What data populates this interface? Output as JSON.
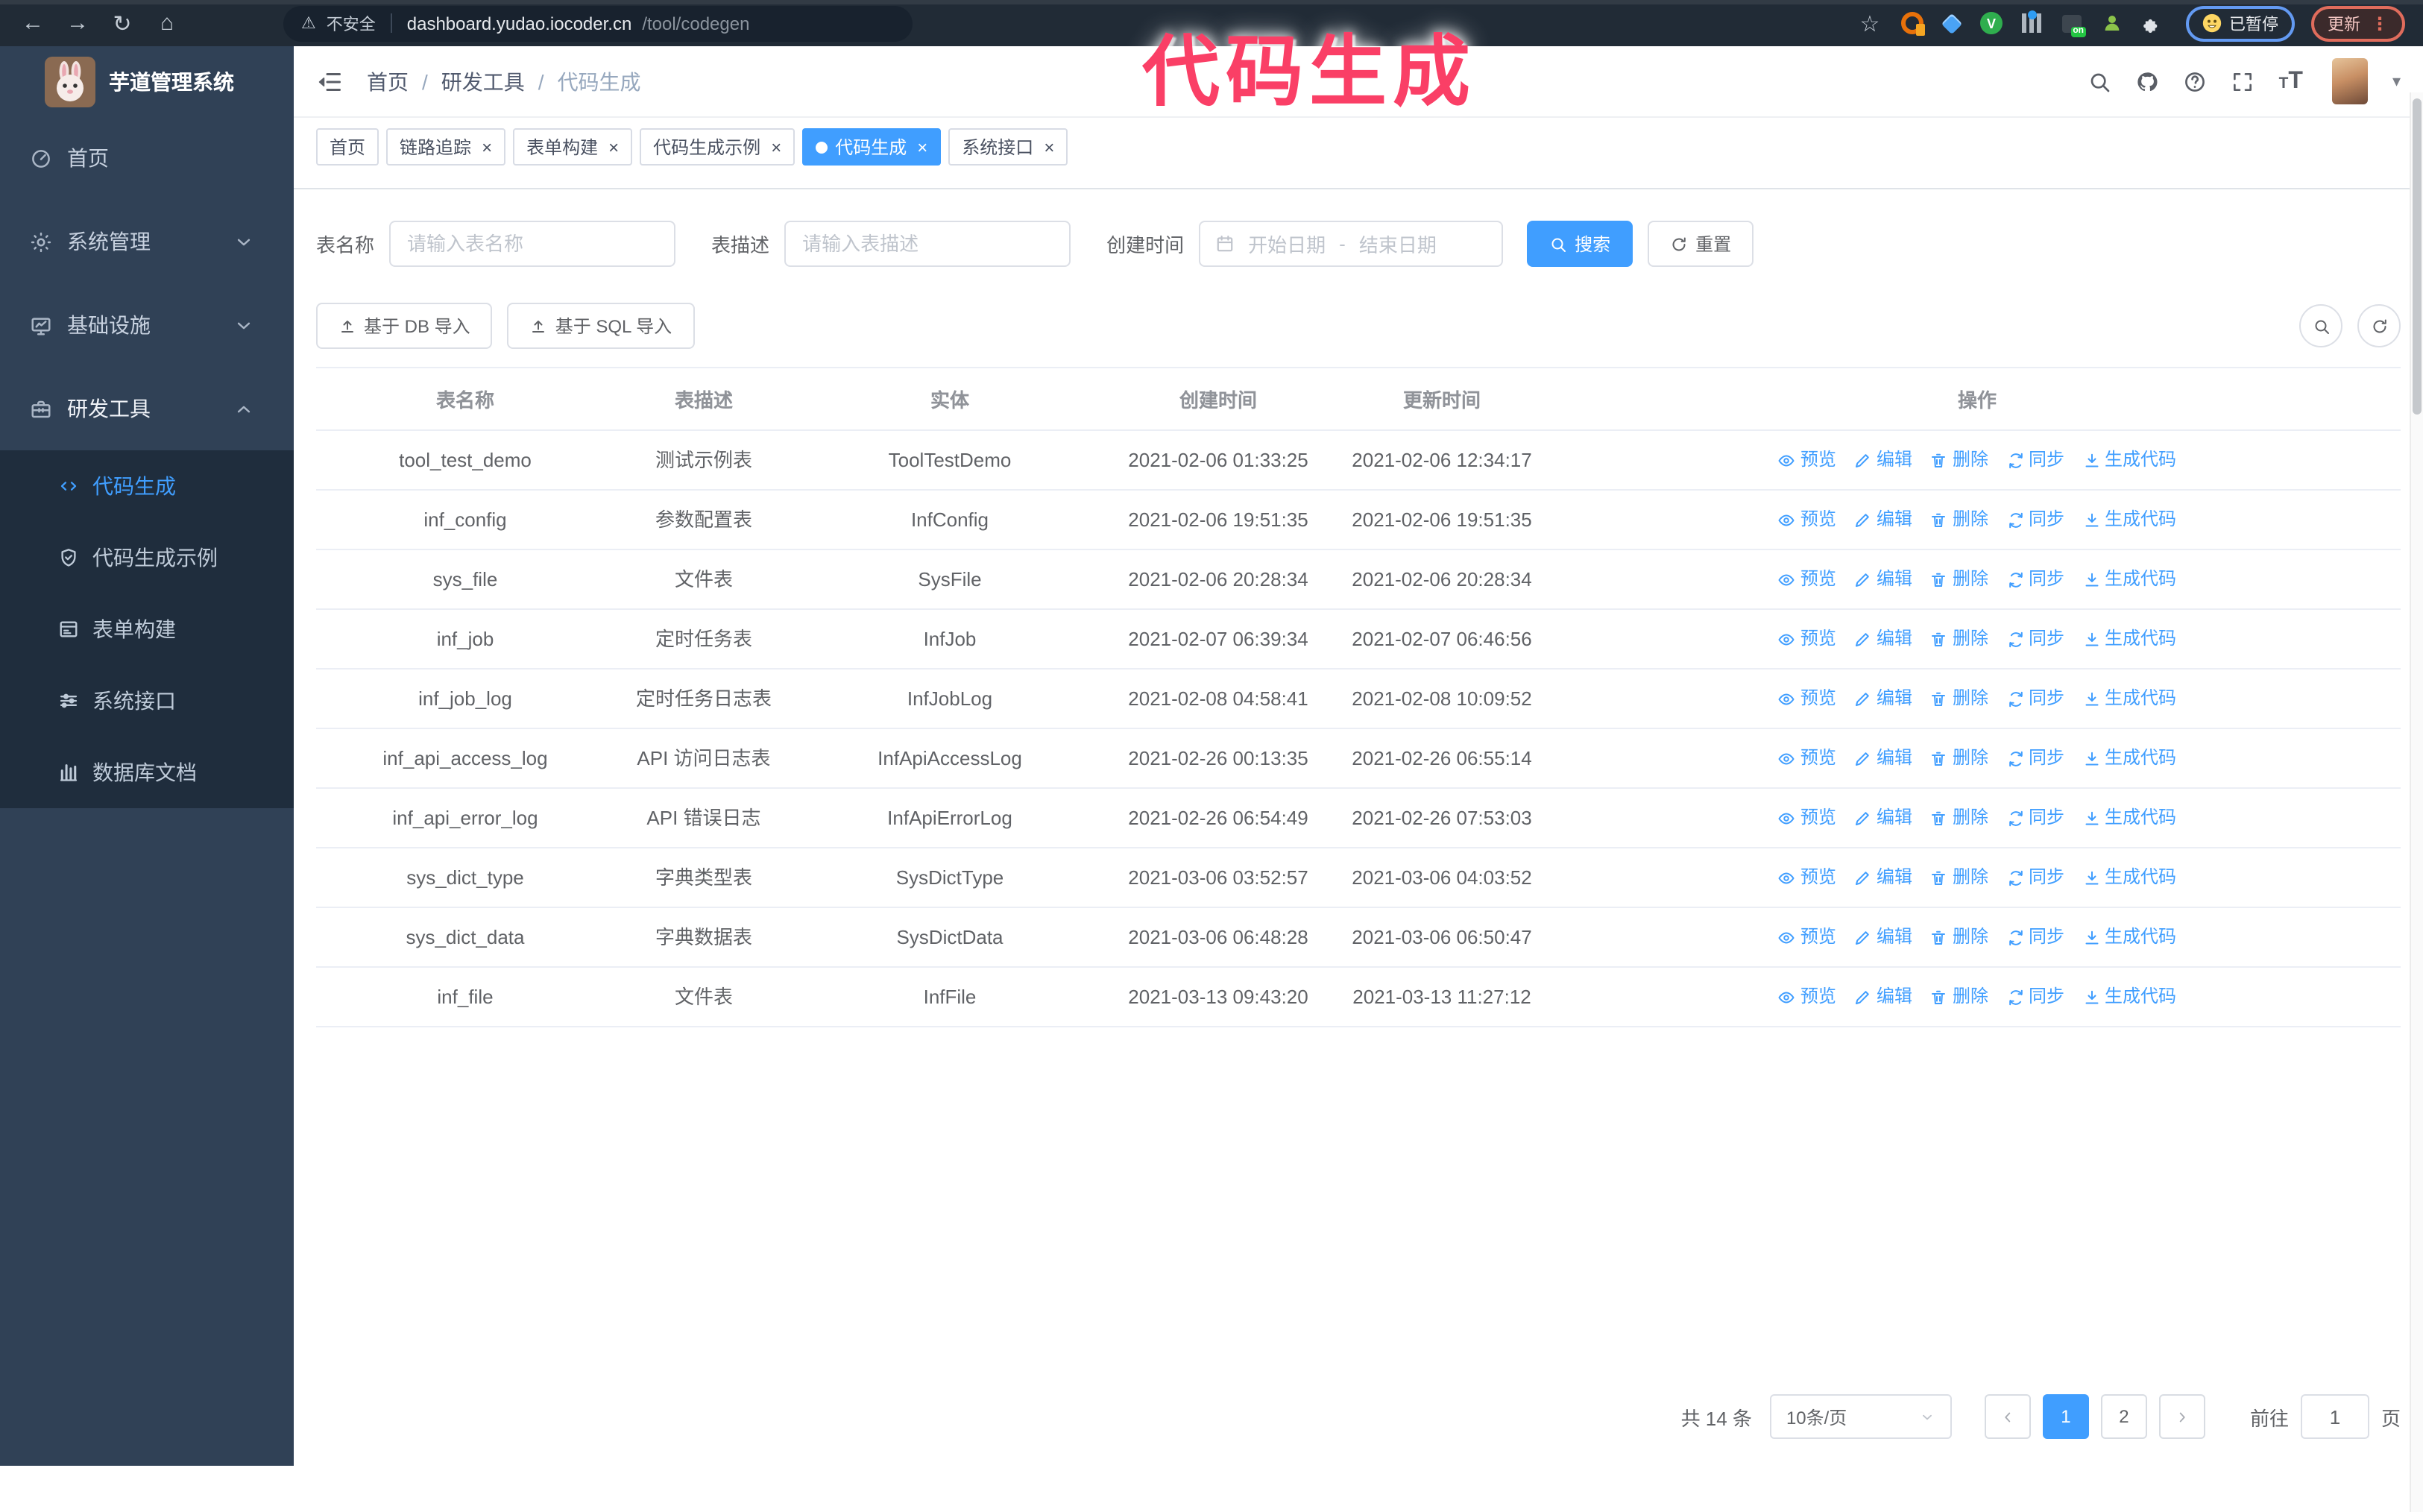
{
  "browser": {
    "security_label": "不安全",
    "url_host": "dashboard.yudao.iocoder.cn",
    "url_path": "/tool/codegen",
    "paused_badge": "已暂停",
    "update_button": "更新"
  },
  "annotation": "代码生成",
  "sidebar": {
    "title": "芋道管理系统",
    "items": [
      {
        "label": "首页",
        "icon": "dashboard-icon",
        "expandable": false
      },
      {
        "label": "系统管理",
        "icon": "gear-icon",
        "expandable": true,
        "expanded": false
      },
      {
        "label": "基础设施",
        "icon": "monitor-icon",
        "expandable": true,
        "expanded": false
      },
      {
        "label": "研发工具",
        "icon": "toolbox-icon",
        "expandable": true,
        "expanded": true
      }
    ],
    "submenu": [
      {
        "label": "代码生成",
        "icon": "code-icon",
        "active": true
      },
      {
        "label": "代码生成示例",
        "icon": "shield-check-icon",
        "active": false
      },
      {
        "label": "表单构建",
        "icon": "form-icon",
        "active": false
      },
      {
        "label": "系统接口",
        "icon": "sliders-icon",
        "active": false
      },
      {
        "label": "数据库文档",
        "icon": "columns-icon",
        "active": false
      }
    ]
  },
  "header": {
    "breadcrumb": [
      "首页",
      "研发工具",
      "代码生成"
    ],
    "separator": "/",
    "right_icons": [
      "search-icon",
      "github-icon",
      "help-icon",
      "fullscreen-icon",
      "font-size-icon"
    ]
  },
  "tabs": [
    {
      "label": "首页",
      "closable": false,
      "active": false
    },
    {
      "label": "链路追踪",
      "closable": true,
      "active": false
    },
    {
      "label": "表单构建",
      "closable": true,
      "active": false
    },
    {
      "label": "代码生成示例",
      "closable": true,
      "active": false
    },
    {
      "label": "代码生成",
      "closable": true,
      "active": true
    },
    {
      "label": "系统接口",
      "closable": true,
      "active": false
    }
  ],
  "filters": {
    "table_name_label": "表名称",
    "table_name_placeholder": "请输入表名称",
    "table_desc_label": "表描述",
    "table_desc_placeholder": "请输入表描述",
    "create_time_label": "创建时间",
    "date_start_placeholder": "开始日期",
    "date_separator": "-",
    "date_end_placeholder": "结束日期",
    "search_label": "搜索",
    "reset_label": "重置"
  },
  "toolbar": {
    "import_db_label": "基于 DB 导入",
    "import_sql_label": "基于 SQL 导入",
    "right_icons": [
      "search-icon",
      "refresh-icon"
    ]
  },
  "table": {
    "columns": [
      "表名称",
      "表描述",
      "实体",
      "创建时间",
      "更新时间",
      "操作"
    ],
    "actions": [
      {
        "label": "预览",
        "icon": "eye-icon",
        "name": "preview"
      },
      {
        "label": "编辑",
        "icon": "edit-icon",
        "name": "edit"
      },
      {
        "label": "删除",
        "icon": "delete-icon",
        "name": "delete"
      },
      {
        "label": "同步",
        "icon": "sync-icon",
        "name": "sync"
      },
      {
        "label": "生成代码",
        "icon": "download-icon",
        "name": "generate-code"
      }
    ],
    "rows": [
      {
        "name": "tool_test_demo",
        "desc": "测试示例表",
        "entity": "ToolTestDemo",
        "created": "2021-02-06 01:33:25",
        "updated": "2021-02-06 12:34:17"
      },
      {
        "name": "inf_config",
        "desc": "参数配置表",
        "entity": "InfConfig",
        "created": "2021-02-06 19:51:35",
        "updated": "2021-02-06 19:51:35"
      },
      {
        "name": "sys_file",
        "desc": "文件表",
        "entity": "SysFile",
        "created": "2021-02-06 20:28:34",
        "updated": "2021-02-06 20:28:34"
      },
      {
        "name": "inf_job",
        "desc": "定时任务表",
        "entity": "InfJob",
        "created": "2021-02-07 06:39:34",
        "updated": "2021-02-07 06:46:56"
      },
      {
        "name": "inf_job_log",
        "desc": "定时任务日志表",
        "entity": "InfJobLog",
        "created": "2021-02-08 04:58:41",
        "updated": "2021-02-08 10:09:52"
      },
      {
        "name": "inf_api_access_log",
        "desc": "API 访问日志表",
        "entity": "InfApiAccessLog",
        "created": "2021-02-26 00:13:35",
        "updated": "2021-02-26 06:55:14"
      },
      {
        "name": "inf_api_error_log",
        "desc": "API 错误日志",
        "entity": "InfApiErrorLog",
        "created": "2021-02-26 06:54:49",
        "updated": "2021-02-26 07:53:03"
      },
      {
        "name": "sys_dict_type",
        "desc": "字典类型表",
        "entity": "SysDictType",
        "created": "2021-03-06 03:52:57",
        "updated": "2021-03-06 04:03:52"
      },
      {
        "name": "sys_dict_data",
        "desc": "字典数据表",
        "entity": "SysDictData",
        "created": "2021-03-06 06:48:28",
        "updated": "2021-03-06 06:50:47"
      },
      {
        "name": "inf_file",
        "desc": "文件表",
        "entity": "InfFile",
        "created": "2021-03-13 09:43:20",
        "updated": "2021-03-13 11:27:12"
      }
    ]
  },
  "pagination": {
    "total_label": "共 14 条",
    "page_size": "10条/页",
    "pages": [
      "1",
      "2"
    ],
    "active_page": "1",
    "goto_label": "前往",
    "goto_value": "1",
    "goto_suffix": "页"
  },
  "colors": {
    "accent": "#409EFF",
    "annotation": "#fa3f66",
    "sidebar_bg": "#304156",
    "submenu_bg": "#1f2d3d",
    "chrome_bg": "#212b36"
  }
}
